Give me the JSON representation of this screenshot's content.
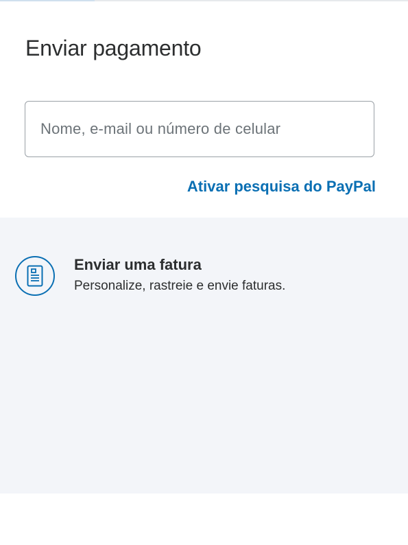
{
  "header": {
    "title": "Enviar pagamento"
  },
  "search": {
    "placeholder": "Nome, e-mail ou número de celular",
    "value": ""
  },
  "search_link": {
    "label": "Ativar pesquisa do PayPal"
  },
  "invoice_option": {
    "icon": "document-icon",
    "title": "Enviar uma fatura",
    "subtitle": "Personalize, rastreie e envie faturas."
  },
  "colors": {
    "accent_blue": "#0a6fb3",
    "text_dark": "#2c2e2f",
    "panel_bg": "#f3f5f9",
    "border_gray": "#9aa0a6"
  }
}
